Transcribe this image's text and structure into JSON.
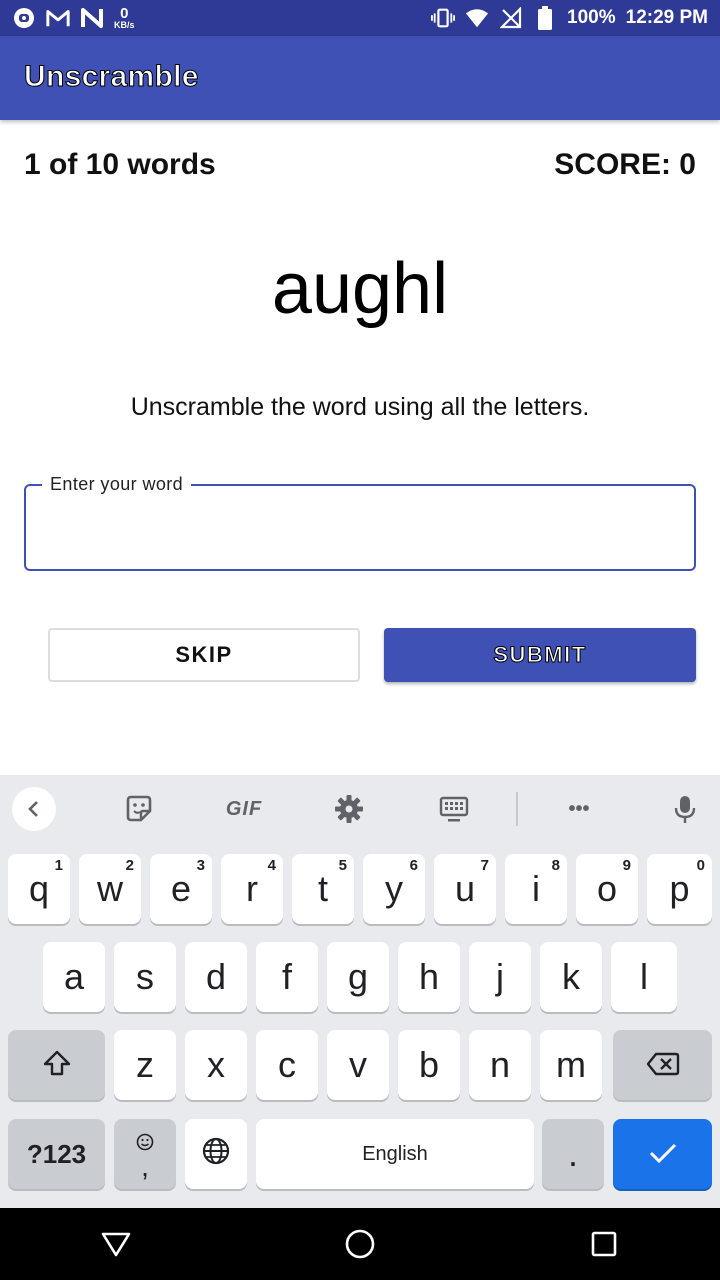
{
  "status_bar": {
    "data_rate_value": "0",
    "data_rate_unit": "KB/s",
    "battery": "100%",
    "time": "12:29 PM"
  },
  "app_bar": {
    "title": "Unscramble"
  },
  "game": {
    "word_count": "1 of 10 words",
    "score": "SCORE: 0",
    "scrambled_word": "aughl",
    "instructions": "Unscramble the word using all the letters."
  },
  "input": {
    "label": "Enter your word",
    "value": ""
  },
  "buttons": {
    "skip": "SKIP",
    "submit": "SUBMIT"
  },
  "keyboard": {
    "toolbar": {
      "gif": "GIF",
      "more": "•••"
    },
    "row1": [
      {
        "key": "q",
        "hint": "1"
      },
      {
        "key": "w",
        "hint": "2"
      },
      {
        "key": "e",
        "hint": "3"
      },
      {
        "key": "r",
        "hint": "4"
      },
      {
        "key": "t",
        "hint": "5"
      },
      {
        "key": "y",
        "hint": "6"
      },
      {
        "key": "u",
        "hint": "7"
      },
      {
        "key": "i",
        "hint": "8"
      },
      {
        "key": "o",
        "hint": "9"
      },
      {
        "key": "p",
        "hint": "0"
      }
    ],
    "row2": [
      "a",
      "s",
      "d",
      "f",
      "g",
      "h",
      "j",
      "k",
      "l"
    ],
    "row3": [
      "z",
      "x",
      "c",
      "v",
      "b",
      "n",
      "m"
    ],
    "symbols_key": "?123",
    "comma_key": ",",
    "space_label": "English",
    "period_key": "."
  },
  "colors": {
    "status_bar": "#2e3a96",
    "primary": "#3f51b5",
    "keyboard_bg": "#e8eaed",
    "enter_key": "#1a73e8"
  },
  "icons": [
    "app-notification-icon",
    "gmail-icon",
    "n-icon",
    "vibrate-icon",
    "wifi-icon",
    "no-signal-icon",
    "battery-icon",
    "back-arrow-icon",
    "sticker-icon",
    "gear-icon",
    "keyboard-icon",
    "microphone-icon",
    "shift-icon",
    "backspace-icon",
    "emoji-icon",
    "globe-icon",
    "check-icon",
    "nav-back-icon",
    "nav-home-icon",
    "nav-recents-icon"
  ]
}
